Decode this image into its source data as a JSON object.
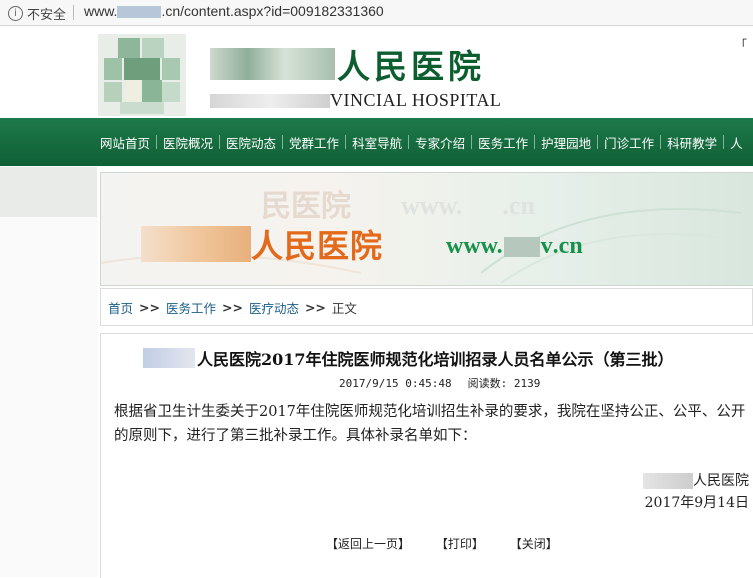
{
  "browser": {
    "security_label": "不安全",
    "url_prefix": "www.",
    "url_suffix": ".cn/content.aspx?id=009182331360"
  },
  "header": {
    "title_cn": "人民医院",
    "title_en": "VINCIAL HOSPITAL",
    "right_text": "「"
  },
  "nav": {
    "items": [
      "网站首页",
      "医院概况",
      "医院动态",
      "党群工作",
      "科室导航",
      "专家介绍",
      "医务工作",
      "护理园地",
      "门诊工作",
      "科研教学",
      "人"
    ]
  },
  "banner": {
    "ghost_name": "民医院",
    "ghost_web": "www.",
    "ghost_web_tail": ".cn",
    "name": "人民医院",
    "web_prefix": "www.",
    "web_mid": "v",
    "web_suffix": ".cn"
  },
  "breadcrumb": {
    "items": [
      "首页",
      "医务工作",
      "医疗动态"
    ],
    "current": "正文",
    "separator": ">>"
  },
  "article": {
    "title": "人民医院2017年住院医师规范化培训招录人员名单公示（第三批）",
    "date": "2017/9/15 0:45:48",
    "views": "阅读数: 2139",
    "body": "根据省卫生计生委关于2017年住院医师规范化培训招生补录的要求，我院在坚持公正、公平、公开的原则下，进行了第三批补录工作。具体补录名单如下：",
    "signature_org": "人民医院",
    "signature_date": "2017年9月14日",
    "link_back": "【返回上一页】",
    "link_print": "【打印】",
    "link_close": "【关闭】"
  },
  "colors": {
    "nav_green": "#16693e",
    "title_green": "#0d5e2f",
    "banner_orange": "#e3691b",
    "link_blue": "#1b5e8a"
  }
}
